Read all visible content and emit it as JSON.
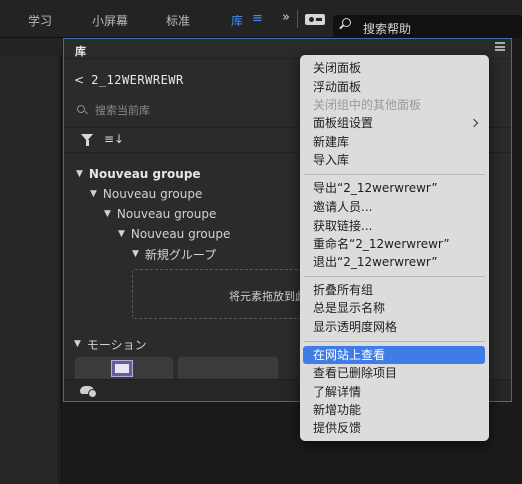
{
  "topbar": {
    "tabs": [
      {
        "label": "学习",
        "active": false
      },
      {
        "label": "小屏幕",
        "active": false
      },
      {
        "label": "标准",
        "active": false
      },
      {
        "label": "库",
        "active": true
      }
    ],
    "more_label": "»",
    "search_label": "搜索帮助"
  },
  "panel": {
    "title": "库",
    "library_name": "2_12WERWREWR",
    "search_placeholder": "搜索当前库",
    "sort_glyph": "≡↓",
    "tree": [
      {
        "label": "Nouveau groupe",
        "level": 0,
        "bold": true
      },
      {
        "label": "Nouveau groupe",
        "level": 1,
        "bold": false
      },
      {
        "label": "Nouveau groupe",
        "level": 2,
        "bold": false
      },
      {
        "label": "Nouveau groupe",
        "level": 3,
        "bold": false
      },
      {
        "label": "新規グループ",
        "level": 4,
        "bold": false
      }
    ],
    "drop_text": "将元素拖放到此处",
    "motion_group": "モーション"
  },
  "menu": {
    "sections": [
      [
        {
          "label": "关闭面板",
          "disabled": false
        },
        {
          "label": "浮动面板",
          "disabled": false
        },
        {
          "label": "关闭组中的其他面板",
          "disabled": true
        },
        {
          "label": "面板组设置",
          "disabled": false,
          "submenu": true
        },
        {
          "label": "新建库",
          "disabled": false
        },
        {
          "label": "导入库",
          "disabled": false
        }
      ],
      [
        {
          "label": "导出“2_12werwrewr”",
          "disabled": false
        },
        {
          "label": "邀请人员...",
          "disabled": false
        },
        {
          "label": "获取链接...",
          "disabled": false
        },
        {
          "label": "重命名“2_12werwrewr”",
          "disabled": false
        },
        {
          "label": "退出“2_12werwrewr”",
          "disabled": false
        }
      ],
      [
        {
          "label": "折叠所有组",
          "disabled": false
        },
        {
          "label": "总是显示名称",
          "disabled": false
        },
        {
          "label": "显示透明度网格",
          "disabled": false
        }
      ],
      [
        {
          "label": "在网站上查看",
          "disabled": false,
          "highlighted": true
        },
        {
          "label": "查看已删除项目",
          "disabled": false
        },
        {
          "label": "了解详情",
          "disabled": false
        },
        {
          "label": "新增功能",
          "disabled": false
        },
        {
          "label": "提供反馈",
          "disabled": false
        }
      ]
    ]
  },
  "colors": {
    "accent": "#3f8ff3",
    "menu_highlight": "#3f7ce6",
    "menu_bg": "#dcdcdc",
    "panel_bg": "#2b2b2b"
  }
}
